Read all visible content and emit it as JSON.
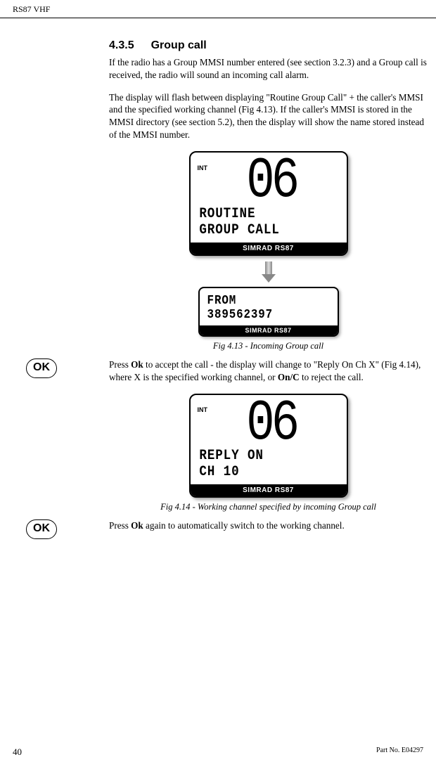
{
  "header": {
    "product": "RS87 VHF"
  },
  "section": {
    "number": "4.3.5",
    "title": "Group call"
  },
  "para1": "If the radio has a Group MMSI number entered (see section 3.2.3) and a Group call is received, the radio will sound an incoming call alarm.",
  "para2": "The display will flash between displaying \"Routine Group Call\" + the caller's MMSI and the specified working channel (Fig 4.13).  If the caller's MMSI is stored in the MMSI directory (see section 5.2), then the display will show the name stored instead of the MMSI number.",
  "lcd1": {
    "int": "INT",
    "channel": "06",
    "line1": "ROUTINE",
    "line2": "GROUP CALL",
    "brand": "SIMRAD RS87"
  },
  "lcd2": {
    "line1": "FROM",
    "line2": "389562397",
    "brand": "SIMRAD RS87"
  },
  "fig413": "Fig 4.13 - Incoming Group call",
  "ok1": "OK",
  "para3_a": "Press ",
  "para3_b": "Ok",
  "para3_c": " to accept the call - the display will change to \"Reply On Ch X\" (Fig 4.14), where X is the specified working channel, or ",
  "para3_d": "On/C",
  "para3_e": " to reject the call.",
  "lcd3": {
    "int": "INT",
    "channel": "06",
    "line1": "REPLY ON",
    "line2": "CH 10",
    "brand": "SIMRAD RS87"
  },
  "fig414": "Fig 4.14 - Working channel specified by incoming Group call",
  "ok2": "OK",
  "para4_a": "Press ",
  "para4_b": "Ok",
  "para4_c": " again to automatically switch to the working channel.",
  "footer": {
    "page": "40",
    "part": "Part No. E04297"
  }
}
